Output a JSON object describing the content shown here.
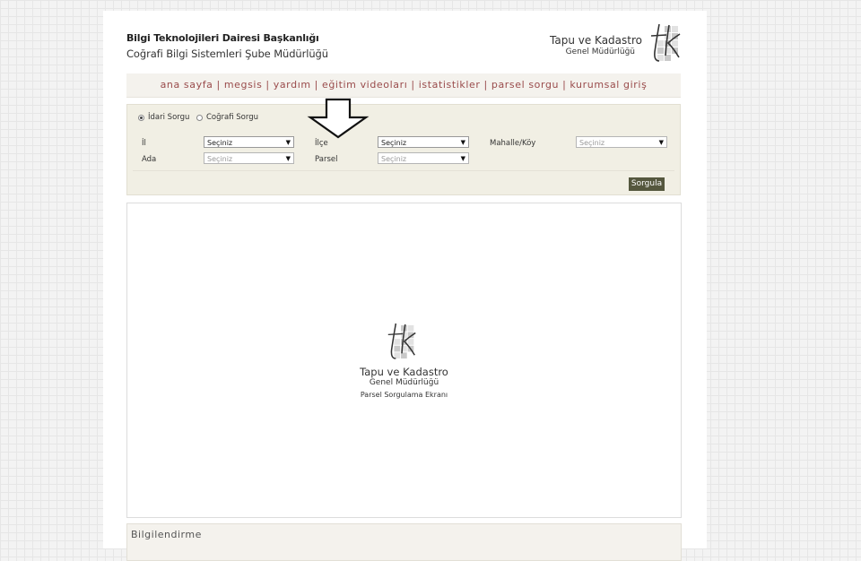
{
  "header": {
    "org_line1": "Bilgi Teknolojileri Dairesi Başkanlığı",
    "org_line2": "Coğrafi Bilgi Sistemleri Şube Müdürlüğü",
    "brand_line1": "Tapu ve Kadastro",
    "brand_line2": "Genel Müdürlüğü"
  },
  "nav": {
    "items": [
      "ana sayfa",
      "megsis",
      "yardım",
      "eğitim videoları",
      "istatistikler",
      "parsel sorgu",
      "kurumsal giriş"
    ],
    "separator": "|"
  },
  "query": {
    "radio_idari": "İdari Sorgu",
    "radio_cografi": "Coğrafi Sorgu",
    "selected_radio": "idari",
    "fields": {
      "il": {
        "label": "İl",
        "value": "Seçiniz"
      },
      "ilce": {
        "label": "İlçe",
        "value": "Seçiniz"
      },
      "mahalle": {
        "label": "Mahalle/Köy",
        "value": "Seçiniz"
      },
      "ada": {
        "label": "Ada",
        "value": "Seçiniz"
      },
      "parsel": {
        "label": "Parsel",
        "value": "Seçiniz"
      }
    },
    "submit_label": "Sorgula"
  },
  "map": {
    "brand_line1": "Tapu ve Kadastro",
    "brand_line2": "Genel Müdürlüğü",
    "subtitle": "Parsel Sorgulama Ekranı"
  },
  "info": {
    "title": "Bilgilendirme"
  },
  "colors": {
    "nav_text": "#9a4c4c",
    "panel_bg": "#f1efe4",
    "button_bg": "#55573e"
  }
}
